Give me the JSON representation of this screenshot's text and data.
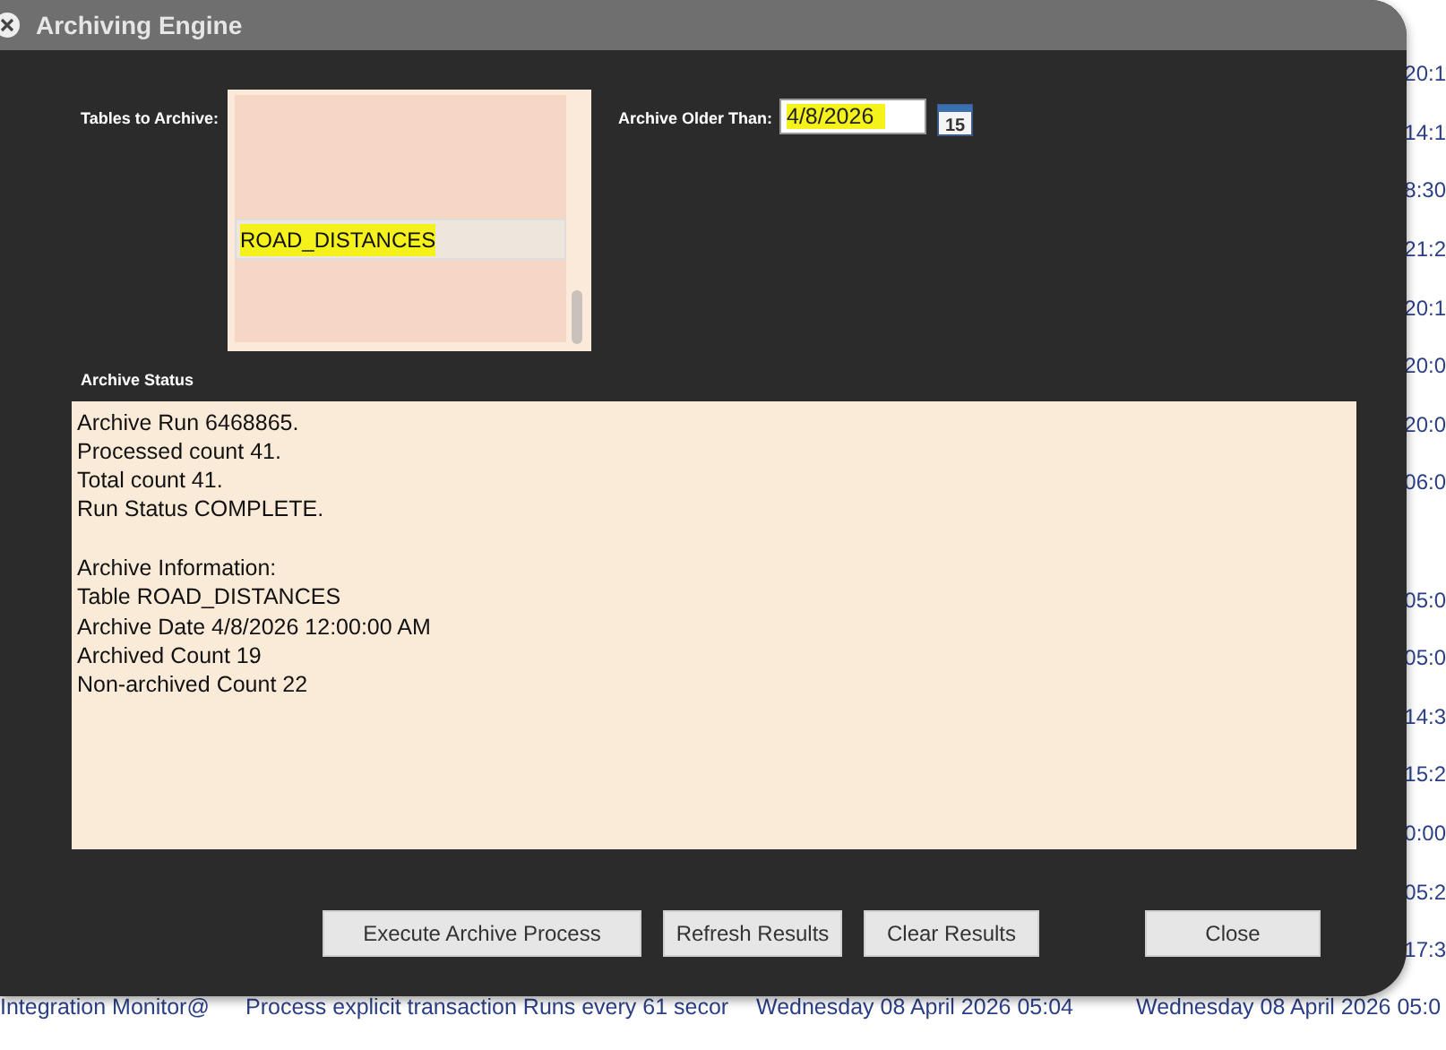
{
  "background_table": {
    "rows": [
      {
        "column_4": "20:1"
      },
      {
        "column_4": "14:1"
      },
      {
        "column_4": "8:30"
      },
      {
        "column_4": "21:2"
      },
      {
        "column_4": "20:1"
      },
      {
        "column_4": "20:0"
      },
      {
        "column_4": "20:0"
      },
      {
        "column_4": "06:0"
      },
      {},
      {
        "column_4": "05:0"
      },
      {
        "column_4": "05:0"
      },
      {
        "column_4": "14:3"
      },
      {
        "column_4": "15:2"
      },
      {
        "column_4": "0:00"
      },
      {
        "column_4": "05:2"
      },
      {
        "column_4": "17:3"
      },
      {
        "column_1": "Integration Monitor@",
        "column_2": "Process explicit transaction Runs every 61 secor",
        "column_3": "Wednesday 08 April 2026 05:04",
        "column_4": "Wednesday 08 April 2026 05:0"
      }
    ]
  },
  "dialog": {
    "title": "Archiving Engine",
    "tables_label": "Tables to Archive:",
    "tables": [
      {
        "kind": "redacted",
        "selected": false
      },
      {
        "kind": "redacted",
        "selected": false
      },
      {
        "kind": "redacted",
        "selected": false
      },
      {
        "kind": "text",
        "text": "ROAD_DISTANCES",
        "selected": true,
        "highlighted": true
      },
      {
        "kind": "redacted",
        "selected": false
      },
      {
        "kind": "redacted",
        "selected": false
      }
    ],
    "date_label": "Archive Older Than:",
    "date_field": {
      "value": "4/8/2026",
      "highlighted": true
    },
    "calendar_icon_text": "15",
    "status_label": "Archive Status",
    "status_groups": [
      [
        "Archive Run 6468865.",
        "Processed count 41.",
        "Total count 41.",
        "Run Status COMPLETE."
      ],
      [
        "Archive Information:",
        "Table ROAD_DISTANCES",
        "Archive Date 4/8/2026 12:00:00 AM",
        "Archived Count 19",
        "Non-archived Count 22"
      ]
    ],
    "buttons": [
      "Execute Archive Process",
      "Refresh Results",
      "Clear Results",
      "Close"
    ]
  }
}
